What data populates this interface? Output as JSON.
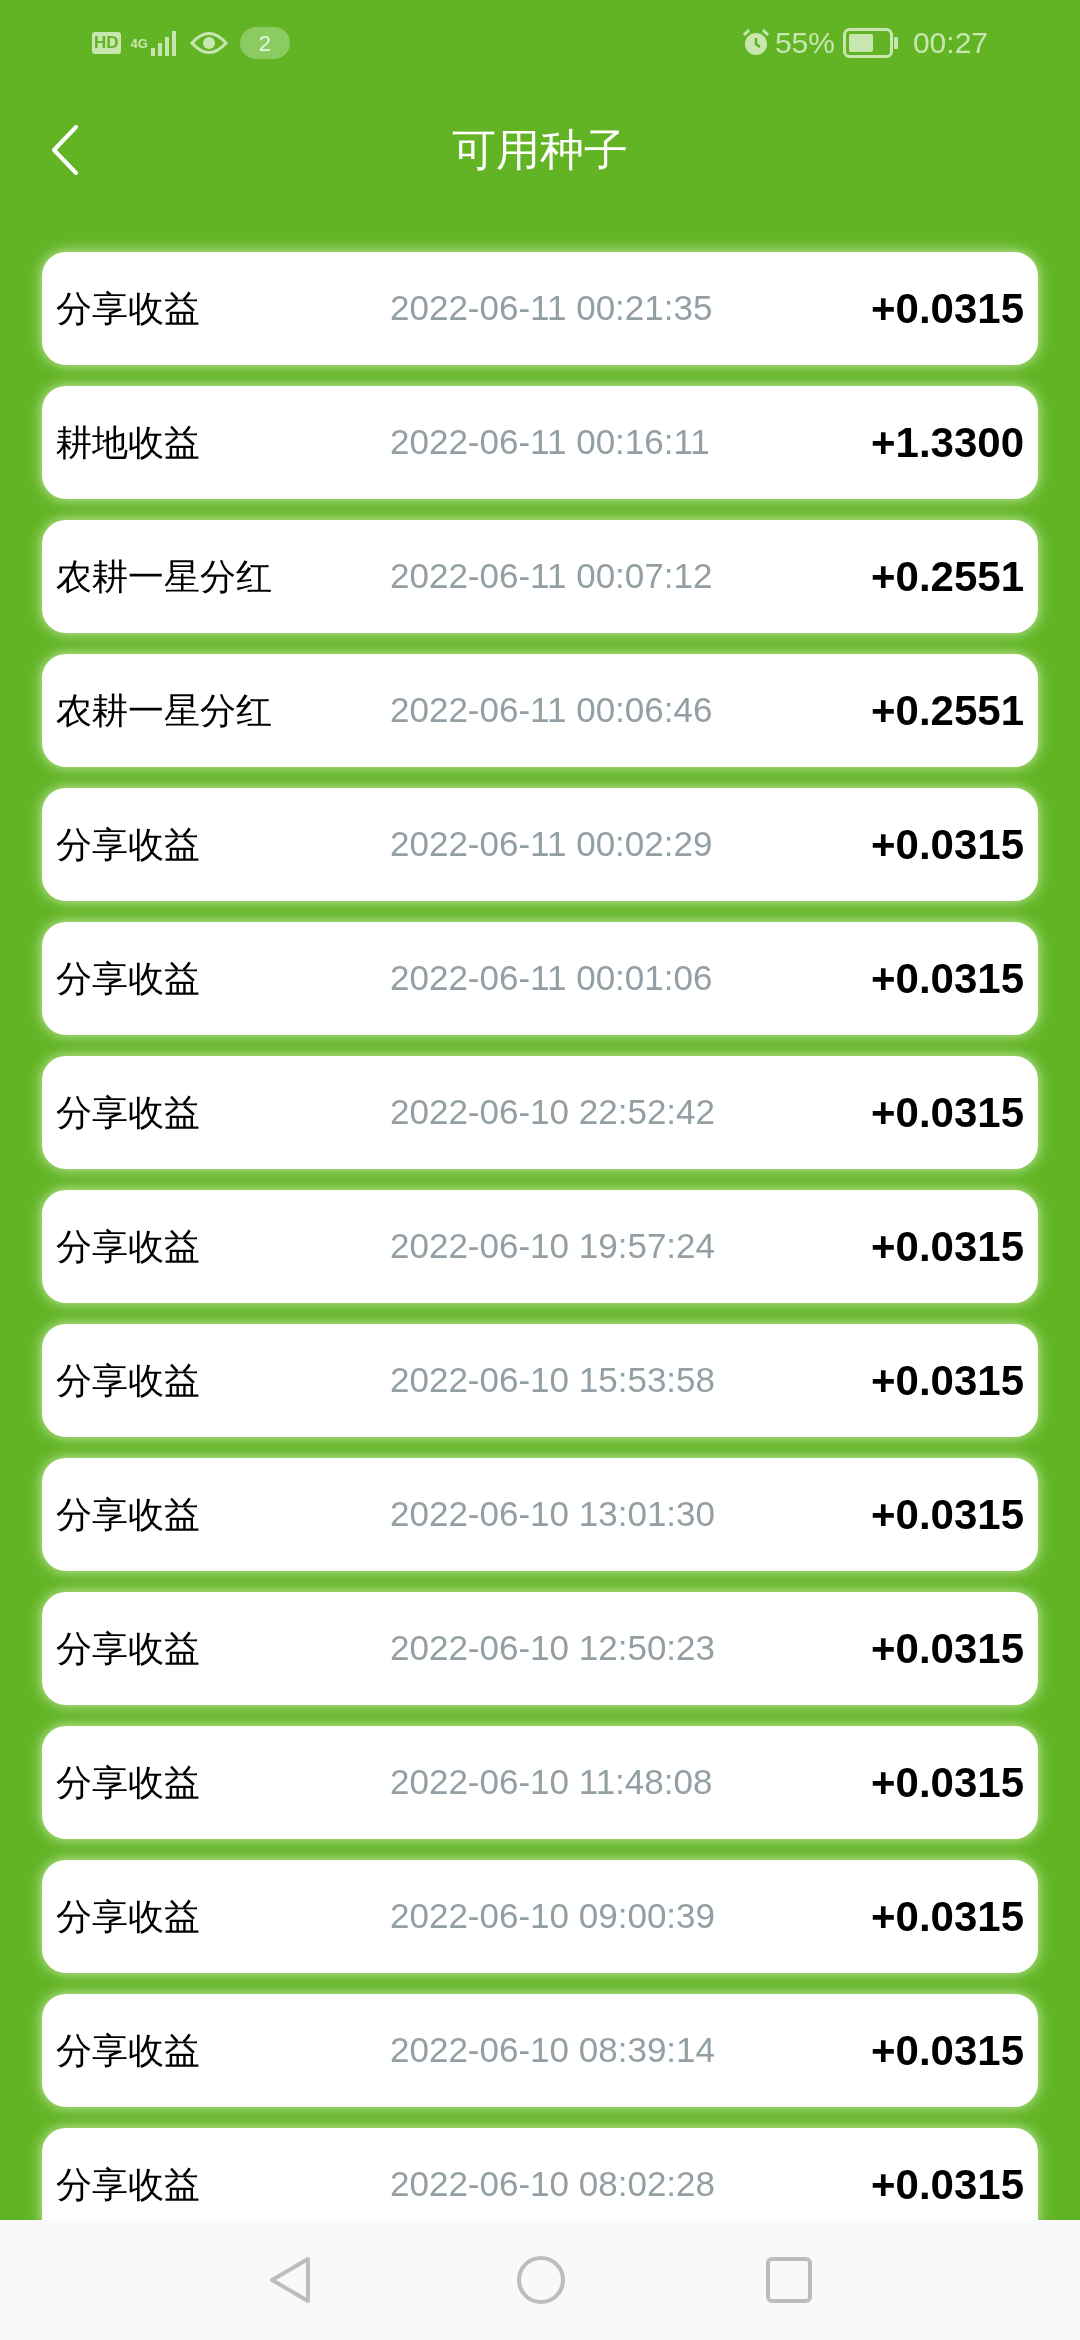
{
  "status_bar": {
    "hd": "HD",
    "network": "4G",
    "notification_count": "2",
    "battery": "55%",
    "time": "00:27"
  },
  "header": {
    "title": "可用种子"
  },
  "records": [
    {
      "label": "分享收益",
      "time": "2022-06-11 00:21:35",
      "amount": "+0.0315"
    },
    {
      "label": "耕地收益",
      "time": "2022-06-11 00:16:11",
      "amount": "+1.3300"
    },
    {
      "label": "农耕一星分红",
      "time": "2022-06-11 00:07:12",
      "amount": "+0.2551"
    },
    {
      "label": "农耕一星分红",
      "time": "2022-06-11 00:06:46",
      "amount": "+0.2551"
    },
    {
      "label": "分享收益",
      "time": "2022-06-11 00:02:29",
      "amount": "+0.0315"
    },
    {
      "label": "分享收益",
      "time": "2022-06-11 00:01:06",
      "amount": "+0.0315"
    },
    {
      "label": "分享收益",
      "time": "2022-06-10 22:52:42",
      "amount": "+0.0315"
    },
    {
      "label": "分享收益",
      "time": "2022-06-10 19:57:24",
      "amount": "+0.0315"
    },
    {
      "label": "分享收益",
      "time": "2022-06-10 15:53:58",
      "amount": "+0.0315"
    },
    {
      "label": "分享收益",
      "time": "2022-06-10 13:01:30",
      "amount": "+0.0315"
    },
    {
      "label": "分享收益",
      "time": "2022-06-10 12:50:23",
      "amount": "+0.0315"
    },
    {
      "label": "分享收益",
      "time": "2022-06-10 11:48:08",
      "amount": "+0.0315"
    },
    {
      "label": "分享收益",
      "time": "2022-06-10 09:00:39",
      "amount": "+0.0315"
    },
    {
      "label": "分享收益",
      "time": "2022-06-10 08:39:14",
      "amount": "+0.0315"
    },
    {
      "label": "分享收益",
      "time": "2022-06-10 08:02:28",
      "amount": "+0.0315"
    }
  ]
}
